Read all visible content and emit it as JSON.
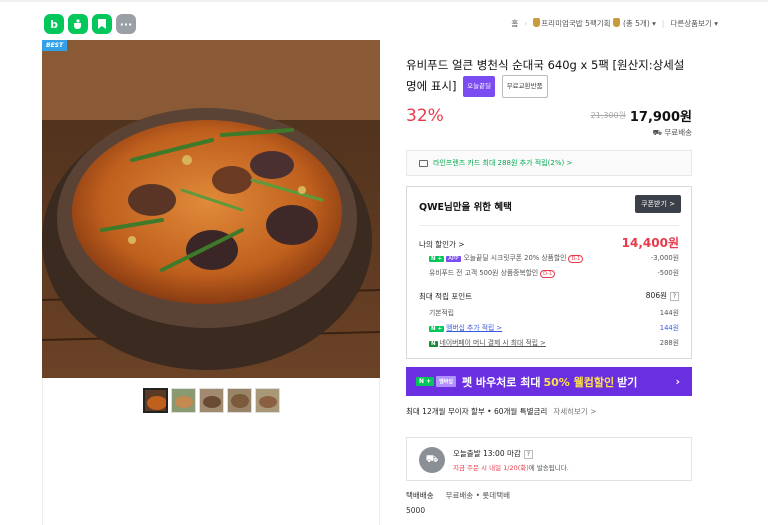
{
  "app_icons": [
    {
      "name": "blog-icon",
      "glyph": "b"
    },
    {
      "name": "cafe-icon",
      "glyph": "☕"
    },
    {
      "name": "bookmark-icon",
      "glyph": "▮"
    },
    {
      "name": "more-icon",
      "glyph": "···"
    }
  ],
  "breadcrumb": {
    "home": "홈",
    "category": "프리미엄국밥 5팩기획",
    "count": "(총 5개)",
    "other": "다른상품보기"
  },
  "product": {
    "badge": "BEST",
    "title": "유비푸드 얼큰 병천식 순대국 640g x 5팩 [원산지:상세설명에 표시]",
    "tag_today": "오늘끝딜",
    "tag_return": "무료교환반품",
    "discount": "32%",
    "original_price": "21,300원",
    "sale_price": "17,900원",
    "shipping": "무료배송"
  },
  "card_banner": "라인프렌즈 카드 최대 288원 추가 적립(2%) >",
  "benefit": {
    "heading": "QWE님만을 위한 혜택",
    "coupon_button": "쿠폰받기 >",
    "my_price_label": "나의 할인가 >",
    "my_price": "14,400원",
    "coupons": [
      {
        "label": "오늘끝딜 시크릿쿠폰 20% 상품할인",
        "dday": "D-1",
        "amount": "-3,000원"
      },
      {
        "label": "유비푸드 전 고객 500원 상품중복할인",
        "dday": "D-1",
        "amount": "-500원"
      }
    ],
    "points_label": "최대 적립 포인트",
    "points_total": "806원",
    "points_help": "?",
    "points": [
      {
        "label": "기본적립",
        "amount": "144원"
      },
      {
        "label": "멤버십 추가 적립 >",
        "amount": "144원"
      },
      {
        "label": "네이버페이 머니 결제 시 최대 적립 >",
        "amount": "288원"
      }
    ]
  },
  "promo": {
    "n_chip": "N +",
    "m_chip": "멤버십",
    "text_before": "펫 바우처로 최대",
    "text_highlight": "50% 웰컴할인",
    "text_after": "받기",
    "arrow": "›"
  },
  "installment": {
    "text": "최대 12개월 무이자 할부 • 60개월 특별금리",
    "link": "자세히보기 >"
  },
  "delivery": {
    "title": "오늘출발 13:00 마감",
    "help": "?",
    "note_red": "지금 주문 시 내일 1/20(화)",
    "note_rest": "에 발송됩니다."
  },
  "shipping_info": {
    "label": "택배배송",
    "value": "무료배송 • 롯데택배",
    "cost": "5000"
  },
  "colors": {
    "naver_green": "#03c75a",
    "discount_red": "#e83a4b",
    "promo_purple": "#6a2fe0"
  }
}
